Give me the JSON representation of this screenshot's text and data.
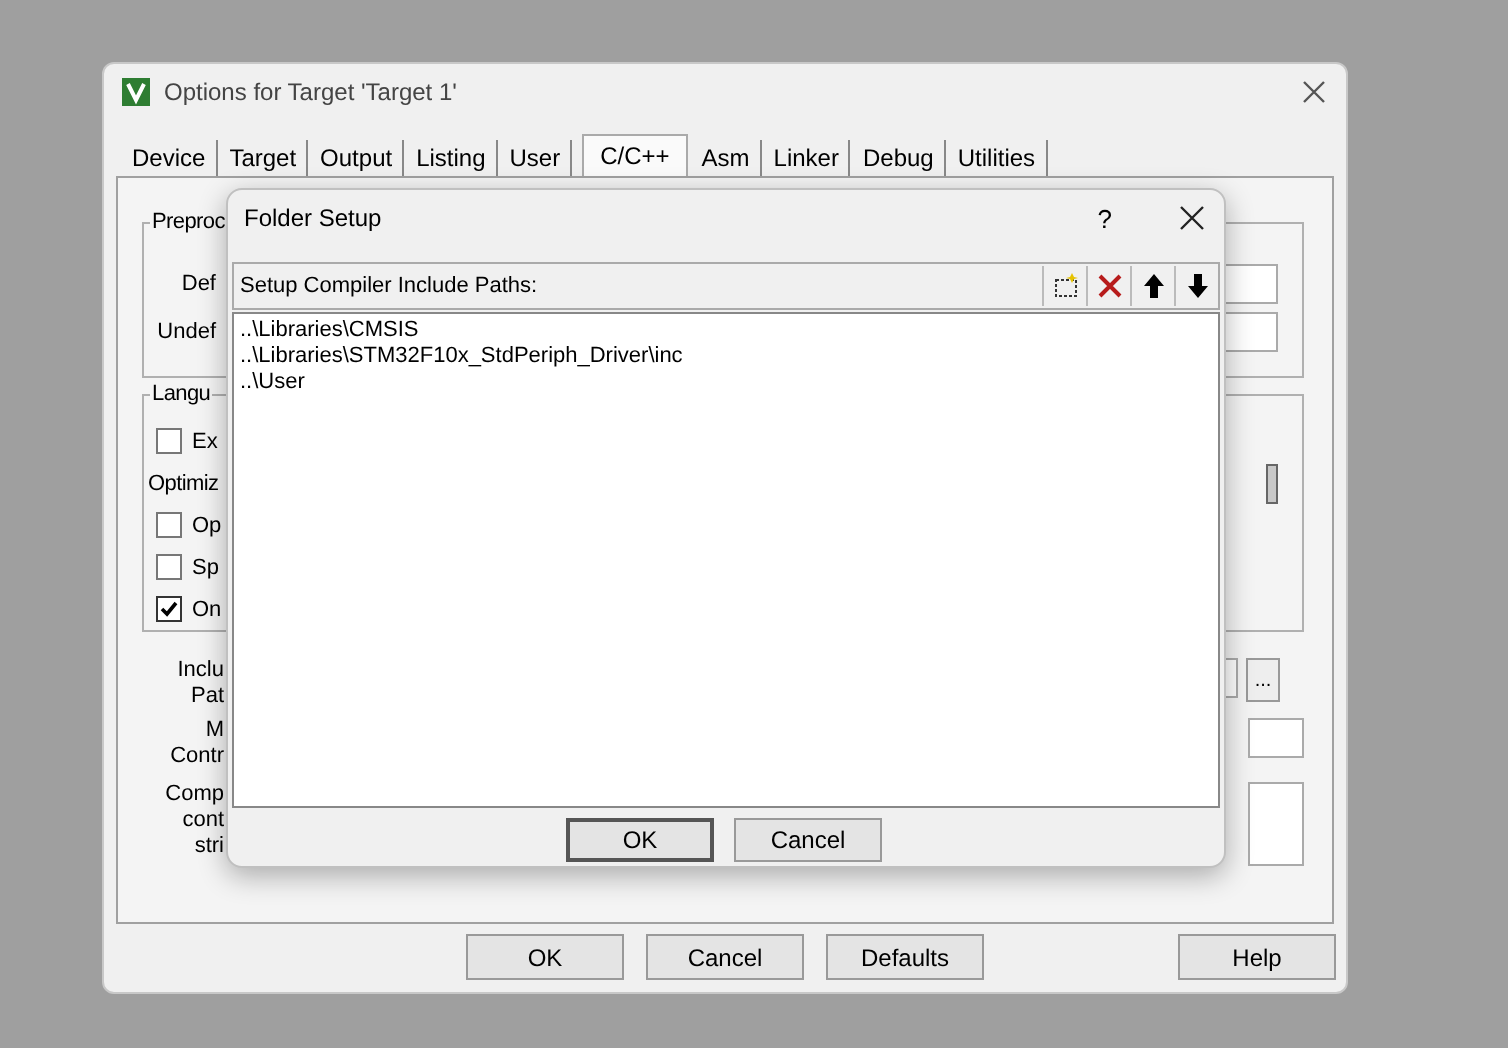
{
  "window": {
    "title": "Options for Target 'Target 1'"
  },
  "tabs": [
    {
      "label": "Device",
      "selected": false
    },
    {
      "label": "Target",
      "selected": false
    },
    {
      "label": "Output",
      "selected": false
    },
    {
      "label": "Listing",
      "selected": false
    },
    {
      "label": "User",
      "selected": false
    },
    {
      "label": "C/C++",
      "selected": true
    },
    {
      "label": "Asm",
      "selected": false
    },
    {
      "label": "Linker",
      "selected": false
    },
    {
      "label": "Debug",
      "selected": false
    },
    {
      "label": "Utilities",
      "selected": false
    }
  ],
  "preprocessor_group": {
    "title": "Preproc",
    "labels": [
      "Def",
      "Undef"
    ]
  },
  "language_group": {
    "title": "Langu",
    "options": [
      {
        "kind": "checkbox",
        "label": "Ex",
        "checked": false
      },
      {
        "kind": "label",
        "label": "Optimiz"
      },
      {
        "kind": "checkbox",
        "label": "Op",
        "checked": false
      },
      {
        "kind": "checkbox",
        "label": "Sp",
        "checked": false
      },
      {
        "kind": "checkbox",
        "label": "On",
        "checked": true
      }
    ]
  },
  "field_labels": [
    {
      "lines": [
        "Inclu",
        "Pat"
      ],
      "browse": "..."
    },
    {
      "lines": [
        "M",
        "Contr"
      ]
    },
    {
      "lines": [
        "Comp",
        "cont",
        "stri"
      ]
    }
  ],
  "dialog": {
    "title": "Folder Setup",
    "help": "?",
    "list_label": "Setup Compiler Include Paths:",
    "paths": [
      "..\\Libraries\\CMSIS",
      "..\\Libraries\\STM32F10x_StdPeriph_Driver\\inc",
      "..\\User"
    ],
    "buttons": [
      {
        "label": "OK",
        "default": true
      },
      {
        "label": "Cancel",
        "default": false
      }
    ]
  },
  "buttons": [
    "OK",
    "Cancel",
    "Defaults",
    "Help"
  ]
}
